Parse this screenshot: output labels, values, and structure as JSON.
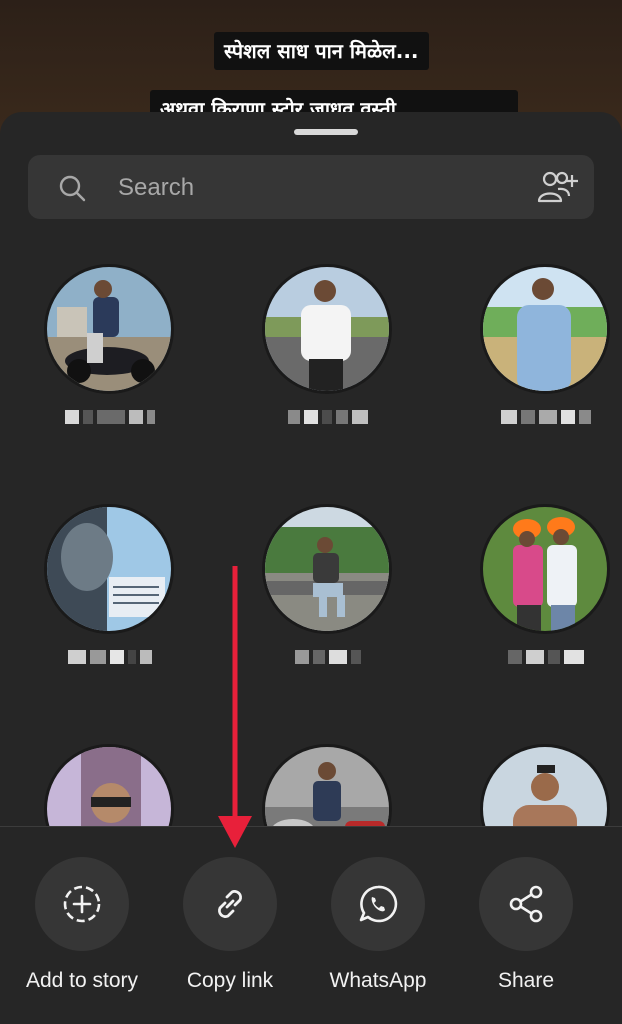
{
  "story_preview": {
    "caption_line1": "स्पेशल साध पान मिळेल...",
    "caption_line2": "अथवा किराणा स्टोर जाधव वस्ती"
  },
  "share_sheet": {
    "search": {
      "placeholder": "Search"
    },
    "contacts": [
      {
        "name": "",
        "row": 1,
        "col": 1
      },
      {
        "name": "",
        "row": 1,
        "col": 2
      },
      {
        "name": "",
        "row": 1,
        "col": 3
      },
      {
        "name": "",
        "row": 2,
        "col": 1
      },
      {
        "name": "",
        "row": 2,
        "col": 2
      },
      {
        "name": "",
        "row": 2,
        "col": 3
      },
      {
        "name": "",
        "row": 3,
        "col": 1
      },
      {
        "name": "",
        "row": 3,
        "col": 2
      },
      {
        "name": "",
        "row": 3,
        "col": 3
      }
    ],
    "actions": [
      {
        "label": "Add to story",
        "icon": "add-story-icon"
      },
      {
        "label": "Copy link",
        "icon": "link-icon"
      },
      {
        "label": "WhatsApp",
        "icon": "whatsapp-icon"
      },
      {
        "label": "Share",
        "icon": "share-icon"
      }
    ]
  },
  "annotation": {
    "arrow_color": "#e8203a"
  },
  "colors": {
    "sheet_bg": "#262626",
    "search_bg": "#363636",
    "action_circle_bg": "#363636",
    "text_primary": "#f2f2f2",
    "text_secondary": "#a8a8a8"
  }
}
